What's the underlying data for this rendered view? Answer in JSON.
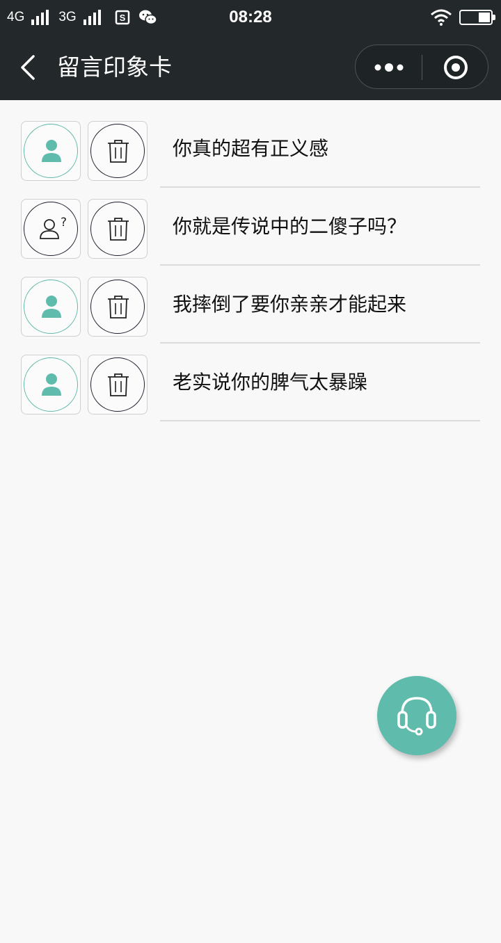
{
  "status_bar": {
    "net1": "4G",
    "net2": "3G",
    "time": "08:28",
    "icons": [
      "signal-icon",
      "sim-icon",
      "wechat-icon",
      "wifi-icon",
      "battery-icon"
    ]
  },
  "nav": {
    "title": "留言印象卡",
    "icons": [
      "back-icon",
      "more-icon",
      "close-target-icon"
    ]
  },
  "messages": [
    {
      "text": "你真的超有正义感",
      "avatar": "person"
    },
    {
      "text": "你就是传说中的二傻子吗？",
      "avatar": "unknown"
    },
    {
      "text": "我摔倒了要你亲亲才能起来",
      "avatar": "person"
    },
    {
      "text": "老实说你的脾气太暴躁",
      "avatar": "person"
    }
  ],
  "colors": {
    "header_bg": "#23282b",
    "accent": "#5fbbab",
    "page_bg": "#f8f8f8"
  }
}
